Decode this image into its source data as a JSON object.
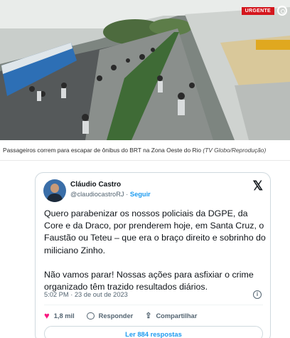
{
  "photo": {
    "badge": "URGENTE",
    "logo_icon": "globo-logo-icon",
    "description_icon": "brt-station-photo"
  },
  "caption": {
    "text": "Passageiros correm para escapar de ônibus do BRT na Zona Oeste do Rio",
    "credit": "(TV Globo/Reprodução)"
  },
  "tweet": {
    "author_name": "Cláudio Castro",
    "handle": "@claudiocastroRJ",
    "separator": "·",
    "follow_label": "Seguir",
    "paragraph_1": "Quero parabenizar os nossos policiais da DGPE, da Core e da Draco, por prenderem hoje, em Santa Cruz, o Faustão ou Teteu – que era o braço direito e sobrinho do miliciano Zinho.",
    "paragraph_2": "Não vamos parar! Nossas ações para asfixiar o crime organizado têm trazido resultados diários.",
    "timestamp": "5:02 PM · 23 de out de 2023",
    "likes": "1,8 mil",
    "reply_label": "Responder",
    "share_label": "Compartilhar",
    "read_replies_label": "Ler 884 respostas",
    "colors": {
      "accent": "#1d9bf0",
      "like": "#f91880",
      "text": "#0f1419",
      "muted": "#536471"
    }
  }
}
